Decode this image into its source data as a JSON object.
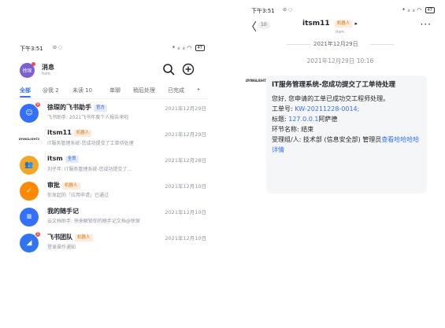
{
  "left": {
    "status": {
      "time": "下午3:51",
      "signal": "* ᵢₗ ᵢₗ",
      "battery": "47"
    },
    "header": {
      "avatar_text": "徐琛",
      "title": "消息",
      "subtitle": "itsm"
    },
    "tabs": [
      "全部",
      "@我 2",
      "未读 10",
      "单聊",
      "稍后处理",
      "已完成"
    ],
    "tab_more": "•",
    "chats": [
      {
        "name": "徐琛的飞书助手",
        "tag": "官方",
        "tag_color": "blue",
        "time": "2021年12月29日",
        "preview": "飞书助手: 2021飞书年度个人报告来啦",
        "avatar_bg": "#3370ff",
        "avatar_glyph": "☺",
        "unread": "9"
      },
      {
        "name": "itsm11",
        "tag": "机器人",
        "tag_color": "orange",
        "time": "2021年12月29日",
        "preview": "IT服务管理系统-您成功提交了工单待处理",
        "avatar_bg": "#ffffff",
        "avatar_glyph": "DYINGLIGHT2",
        "unread": ""
      },
      {
        "name": "itsm",
        "tag": "全员",
        "tag_color": "blue",
        "time": "2021年12月28日",
        "preview": "刘子年: IT服务管理系统-您成功提交了...",
        "avatar_bg": "#f5a623",
        "avatar_glyph": "👥",
        "unread": ""
      },
      {
        "name": "审批",
        "tag": "机器人",
        "tag_color": "orange",
        "time": "2021年12月10日",
        "preview": "你发起的「应用申请」已通过",
        "avatar_bg": "#ff8800",
        "avatar_glyph": "✓",
        "unread": ""
      },
      {
        "name": "我的随手记",
        "tag": "",
        "tag_color": "",
        "time": "2021年12月10日",
        "preview": "云文档助手: 快来解锁你的随手记文档@徐琛",
        "avatar_bg": "#3370ff",
        "avatar_glyph": "≡",
        "unread": ""
      },
      {
        "name": "飞书团队",
        "tag": "机器人",
        "tag_color": "orange",
        "time": "2021年12月10日",
        "preview": "登录操作通知",
        "avatar_bg": "#2e74f5",
        "avatar_glyph": "◢",
        "unread": "1"
      }
    ]
  },
  "right": {
    "status": {
      "time": "下午3:51",
      "signal": "* ᵢₗ ᵢₗ",
      "battery": "47"
    },
    "nav": {
      "back_count": "10",
      "title": "itsm11",
      "title_tag": "机器人",
      "title_arrow": "▸",
      "subtitle": "itsm",
      "more": "···"
    },
    "date_divider": "2021年12月29日",
    "message_time": "2021年12月29日 10:16",
    "bot_avatar_text": "DYINGLIGHT2",
    "card": {
      "title": "IT服务管理系统-您成功提交了工单待处理",
      "line1": "您好, 您申请的工单已成功交工程师处理。",
      "ticket_label": "工单号: ",
      "ticket_value": "KW-20211228-0014",
      "ticket_end": ";",
      "subject_label": "标题: ",
      "subject_value": "127.0.0.1",
      "subject_rest": "阿萨德",
      "node": "环节名称: 结束",
      "assignee": "受理组/人: 技术部 (信息安全部) 管理员",
      "link": "查看哈哈哈哈详情"
    }
  }
}
